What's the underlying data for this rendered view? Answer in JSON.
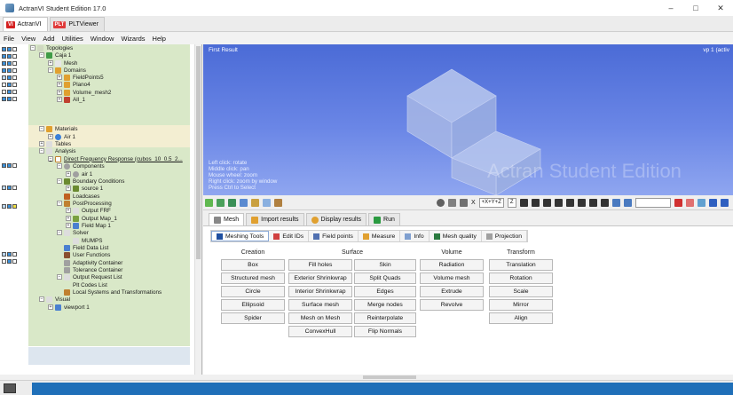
{
  "window": {
    "title": "ActranVI Student Edition 17.0",
    "controls": [
      "–",
      "□",
      "✕"
    ]
  },
  "app_tabs": [
    {
      "tag": "VI",
      "label": "ActranVI"
    },
    {
      "tag": "PLT",
      "label": "PLTViewer"
    }
  ],
  "menu": [
    "File",
    "View",
    "Add",
    "Utilities",
    "Window",
    "Wizards",
    "Help"
  ],
  "tree": [
    {
      "label": "Topologies"
    },
    {
      "label": "Caja 1"
    },
    {
      "label": "Mesh"
    },
    {
      "label": "Domains"
    },
    {
      "label": "FieldPoints5"
    },
    {
      "label": "Plano4"
    },
    {
      "label": "Volume_mesh2"
    },
    {
      "label": "All_1"
    },
    {
      "label": "Materials"
    },
    {
      "label": "Air 1"
    },
    {
      "label": "Tables"
    },
    {
      "label": "Analysis"
    },
    {
      "label": "Direct Frequency Response (cubos_10_0.5_2..."
    },
    {
      "label": "Components"
    },
    {
      "label": "air 1"
    },
    {
      "label": "Boundary Conditions"
    },
    {
      "label": "source 1"
    },
    {
      "label": "Loadcases"
    },
    {
      "label": "PostProcessing"
    },
    {
      "label": "Output FRF"
    },
    {
      "label": "Output Map_1"
    },
    {
      "label": "Field Map 1"
    },
    {
      "label": "Solver"
    },
    {
      "label": "MUMPS"
    },
    {
      "label": "Field Data List"
    },
    {
      "label": "User Functions"
    },
    {
      "label": "Adaptivity Container"
    },
    {
      "label": "Tolerance Container"
    },
    {
      "label": "Output Request List"
    },
    {
      "label": "Plt Codes List"
    },
    {
      "label": "Local Systems and Transformations"
    },
    {
      "label": "Visual"
    },
    {
      "label": "viewport 1"
    }
  ],
  "viewport": {
    "title": "First Result",
    "label": "vp 1 (activ",
    "hints": [
      "Left click: rotate",
      "Middle click: pan",
      "Mouse wheel: zoom",
      "Right click: zoom by window",
      "Press Ctrl to Select"
    ],
    "watermark": "Actran Student Edition"
  },
  "toolbar": {
    "axis_view": "+X+Y+Z",
    "axis_dir": "Z",
    "x_label": "X"
  },
  "tool_tabs": [
    "Mesh",
    "Import results",
    "Display results",
    "Run"
  ],
  "sub_tabs": [
    "Meshing Tools",
    "Edit IDs",
    "Field points",
    "Measure",
    "Info",
    "Mesh quality",
    "Projection"
  ],
  "columns": {
    "creation": {
      "title": "Creation",
      "buttons": [
        "Box",
        "Structured mesh",
        "Circle",
        "Ellipsoid",
        "Spider"
      ]
    },
    "surface": {
      "title": "Surface",
      "left": [
        "Fill holes",
        "Exterior Shrinkwrap",
        "Interior Shrinkwrap",
        "Surface mesh",
        "Mesh on Mesh",
        "ConvexHull"
      ],
      "right": [
        "Skin",
        "Split Quads",
        "Edges",
        "Merge nodes",
        "Reinterpolate",
        "Flip Normals"
      ]
    },
    "volume": {
      "title": "Volume",
      "buttons": [
        "Radiation",
        "Volume mesh",
        "Extrude",
        "Revolve"
      ]
    },
    "transform": {
      "title": "Transform",
      "buttons": [
        "Translation",
        "Rotation",
        "Scale",
        "Mirror",
        "Align"
      ]
    }
  }
}
